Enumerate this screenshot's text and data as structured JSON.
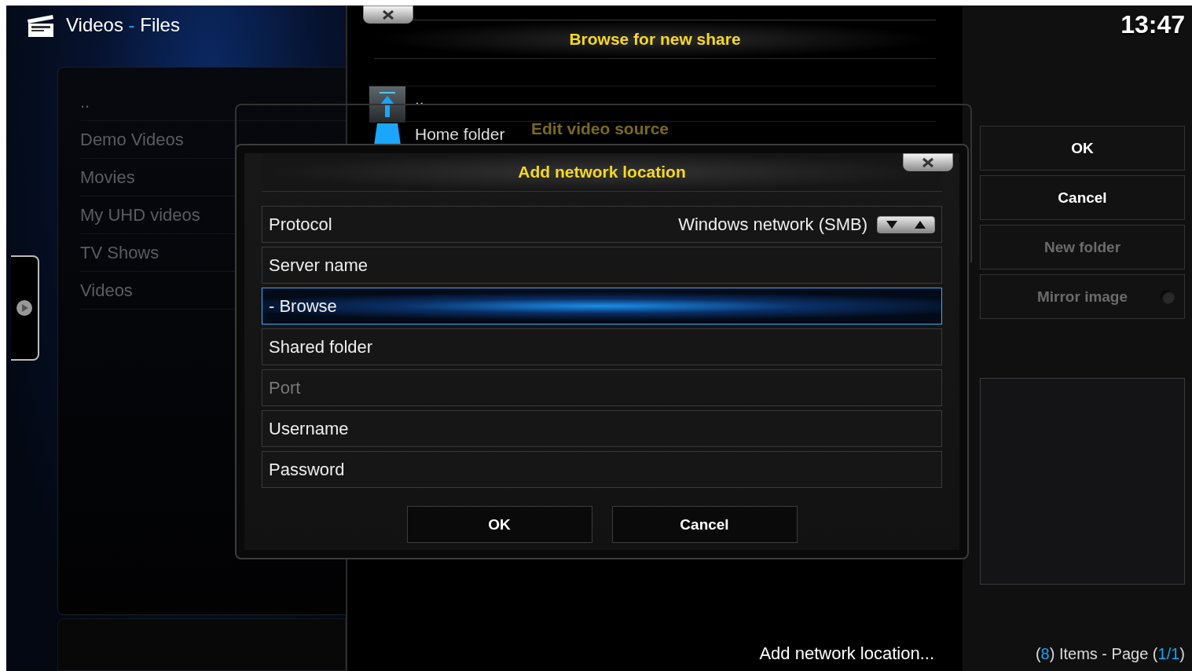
{
  "header": {
    "segments": [
      {
        "text": "Videos",
        "highlight": false
      },
      {
        "text": "-",
        "highlight": true
      },
      {
        "text": "Files",
        "highlight": false
      }
    ]
  },
  "library": {
    "items": [
      {
        "label": ".."
      },
      {
        "label": "Demo Videos"
      },
      {
        "label": "Movies"
      },
      {
        "label": "My UHD videos"
      },
      {
        "label": "TV Shows"
      },
      {
        "label": "Videos"
      }
    ]
  },
  "browse_dialog": {
    "title": "Browse for new share",
    "items": [
      {
        "label": "..",
        "kind": "parent"
      },
      {
        "label": "Home folder",
        "kind": "home"
      }
    ],
    "footer": "Add network location..."
  },
  "edit_dialog": {
    "title": "Edit video source"
  },
  "network_dialog": {
    "title": "Add network location",
    "fields": [
      {
        "label": "Protocol",
        "value": "Windows network (SMB)",
        "kind": "spinner",
        "selected": false,
        "disabled": false
      },
      {
        "label": "Server name",
        "kind": "text",
        "selected": false,
        "disabled": false
      },
      {
        "label": "- Browse",
        "kind": "text",
        "selected": true,
        "disabled": false
      },
      {
        "label": "Shared folder",
        "kind": "text",
        "selected": false,
        "disabled": false
      },
      {
        "label": "Port",
        "kind": "text",
        "selected": false,
        "disabled": true
      },
      {
        "label": "Username",
        "kind": "text",
        "selected": false,
        "disabled": false
      },
      {
        "label": "Password",
        "kind": "text",
        "selected": false,
        "disabled": false
      }
    ],
    "buttons": [
      "OK",
      "Cancel"
    ]
  },
  "clock": "13:47",
  "side_buttons": [
    {
      "label": "OK",
      "kind": "button",
      "disabled": false
    },
    {
      "label": "Cancel",
      "kind": "button",
      "disabled": false
    },
    {
      "label": "New folder",
      "kind": "button",
      "disabled": true
    },
    {
      "label": "Mirror image",
      "kind": "toggle",
      "disabled": true,
      "on": false
    }
  ],
  "status": {
    "segments": [
      {
        "text": "(",
        "highlight": false
      },
      {
        "text": "8",
        "highlight": true
      },
      {
        "text": ") Items - Page (",
        "highlight": false
      },
      {
        "text": "1/1",
        "highlight": true
      },
      {
        "text": ")",
        "highlight": false
      }
    ]
  }
}
